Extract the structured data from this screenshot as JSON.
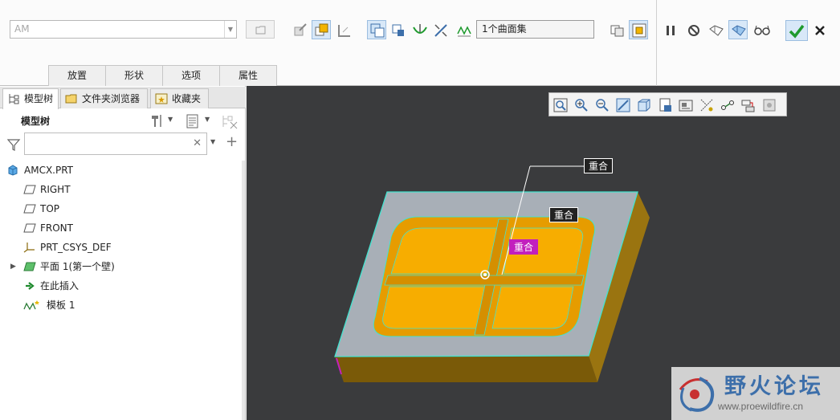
{
  "ribbon": {
    "reference_combo_value": "AM",
    "surface_collector_value": "1个曲面集",
    "tabs": [
      "放置",
      "形状",
      "选项",
      "属性"
    ]
  },
  "left_panel": {
    "nav_tabs": [
      "模型树",
      "文件夹浏览器",
      "收藏夹"
    ],
    "header": "模型树",
    "search_placeholder": "",
    "tree": [
      {
        "label": "AMCX.PRT",
        "icon": "part-icon"
      },
      {
        "label": "RIGHT",
        "icon": "datum-plane-icon"
      },
      {
        "label": "TOP",
        "icon": "datum-plane-icon"
      },
      {
        "label": "FRONT",
        "icon": "datum-plane-icon"
      },
      {
        "label": "PRT_CSYS_DEF",
        "icon": "csys-icon"
      },
      {
        "label": "平面 1(第一个壁)",
        "icon": "sheetmetal-wall-icon"
      },
      {
        "label": "在此插入",
        "icon": "insert-arrow-icon"
      },
      {
        "label": "模板 1",
        "icon": "template-icon"
      }
    ]
  },
  "viewport": {
    "annotations": [
      "重合",
      "重合",
      "重合"
    ]
  },
  "watermark": {
    "title": "野火论坛",
    "url": "www.proewildfire.cn"
  },
  "colors": {
    "viewport_bg": "#3a3b3d",
    "plate_top": "#a9b0b8",
    "plate_side": "#8a6a0c",
    "cavity": "#f0a800",
    "edge_highlight": "#40e0d0",
    "accept_green": "#1f9a2e"
  }
}
